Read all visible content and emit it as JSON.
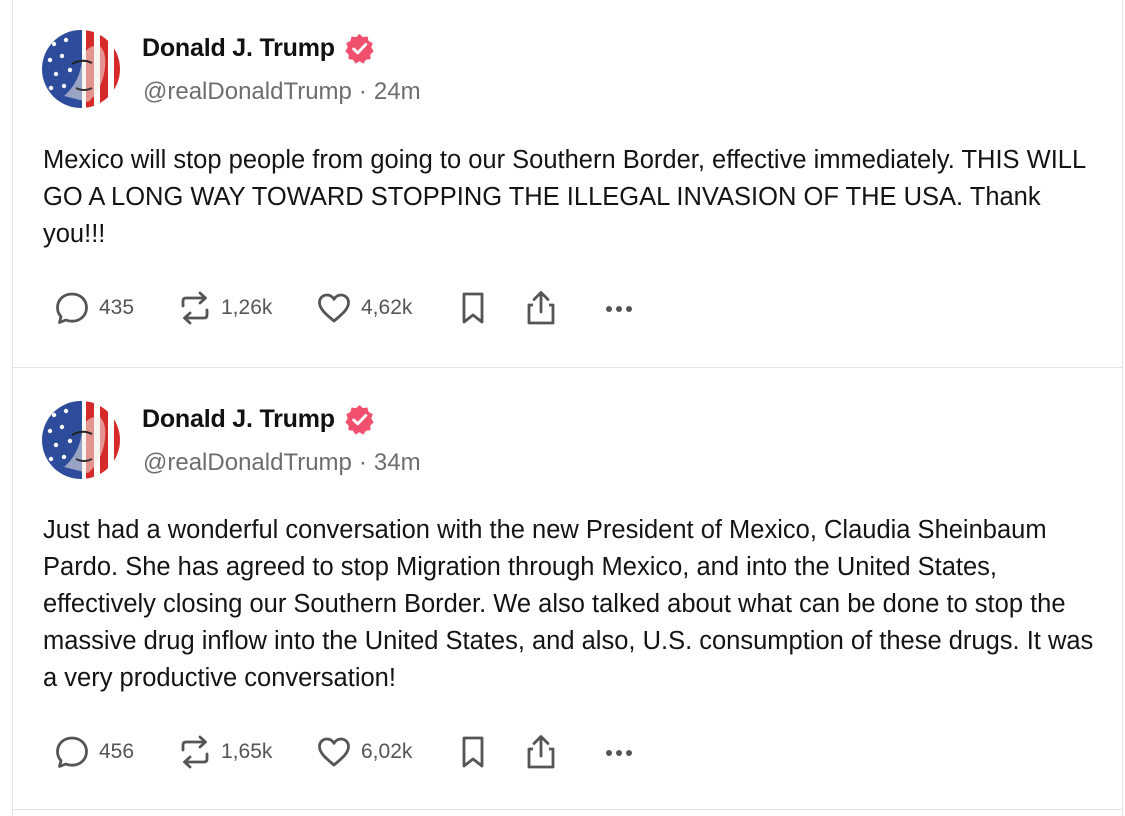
{
  "posts": [
    {
      "author": {
        "name": "Donald J. Trump",
        "handle": "@realDonaldTrump",
        "time": "24m",
        "verified": true,
        "avatar_icon": "flag-portrait-avatar"
      },
      "text": "Mexico will stop people from going to our Southern Border, effective immediately. THIS WILL GO A LONG WAY TOWARD STOPPING THE ILLEGAL INVASION OF THE USA. Thank you!!!",
      "stats": {
        "replies": "435",
        "retruths": "1,26k",
        "likes": "4,62k"
      },
      "actions": [
        "reply-icon",
        "retruth-icon",
        "like-icon",
        "bookmark-icon",
        "share-icon",
        "more-icon"
      ]
    },
    {
      "author": {
        "name": "Donald J. Trump",
        "handle": "@realDonaldTrump",
        "time": "34m",
        "verified": true,
        "avatar_icon": "flag-portrait-avatar"
      },
      "text": "Just had a wonderful conversation with the new President of Mexico, Claudia Sheinbaum Pardo. She has agreed to stop Migration through Mexico, and into the United States, effectively closing our Southern Border. We also talked about what can be done to stop the massive drug inflow into the United States, and also, U.S. consumption of these drugs. It was a very productive conversation!",
      "stats": {
        "replies": "456",
        "retruths": "1,65k",
        "likes": "6,02k"
      },
      "actions": [
        "reply-icon",
        "retruth-icon",
        "like-icon",
        "bookmark-icon",
        "share-icon",
        "more-icon"
      ]
    }
  ],
  "colors": {
    "verified_badge": "#f0506e",
    "text_primary": "#111111",
    "text_secondary": "#6e6e6e",
    "icon": "#555555",
    "divider": "#e3e3e3"
  }
}
